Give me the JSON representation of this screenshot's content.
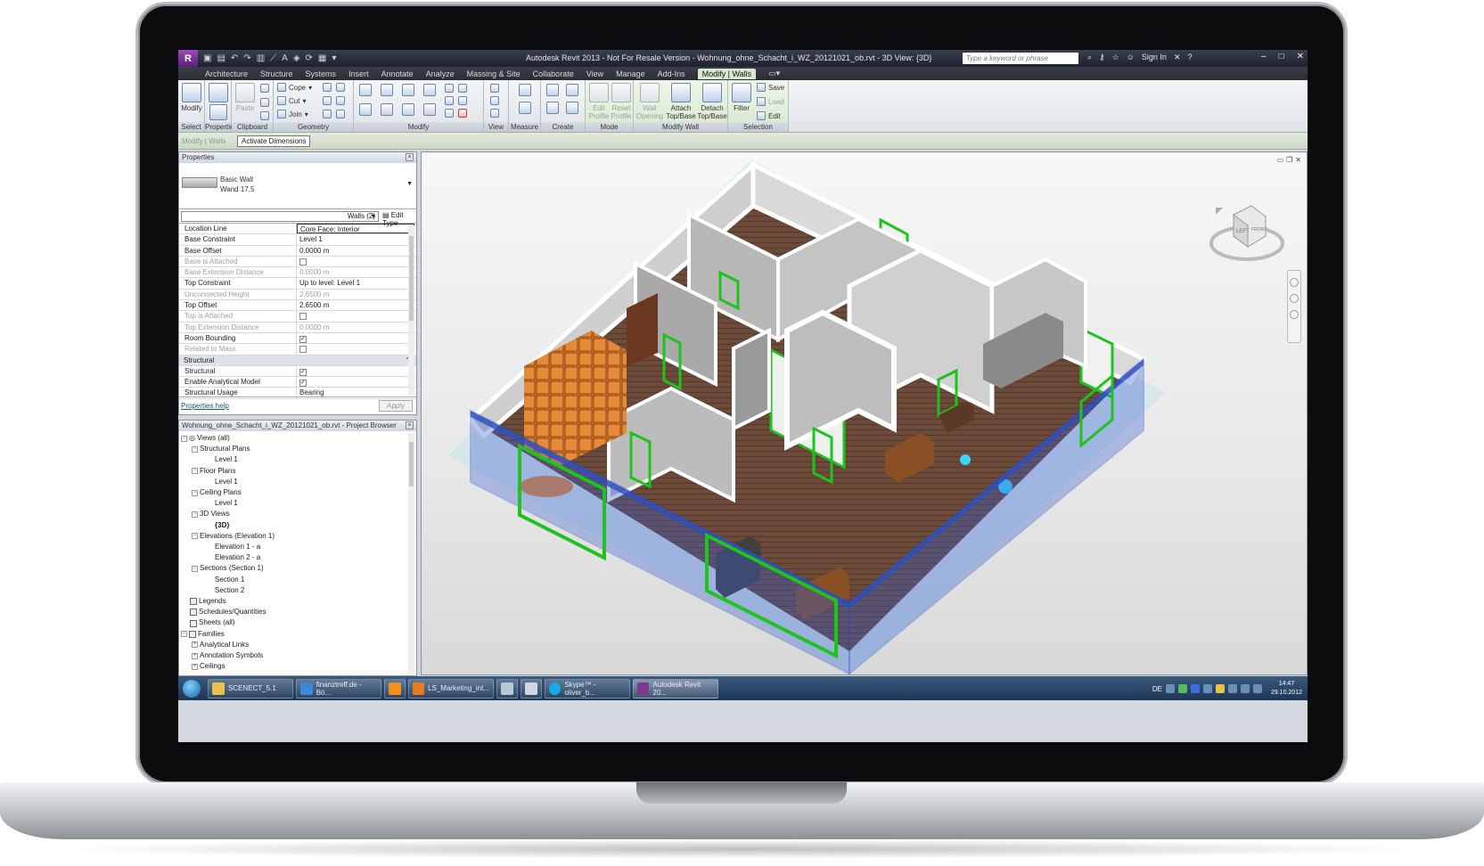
{
  "window": {
    "app_badge": "R",
    "title": "Autodesk Revit 2013 - Not For Resale Version -   Wohnung_ohne_Schacht_i_WZ_20121021_ob.rvt - 3D View: {3D}",
    "search_placeholder": "Type a keyword or phrase",
    "sign_in": "Sign In"
  },
  "tabs": [
    "Architecture",
    "Structure",
    "Systems",
    "Insert",
    "Annotate",
    "Analyze",
    "Massing & Site",
    "Collaborate",
    "View",
    "Manage",
    "Add-Ins",
    "Modify | Walls"
  ],
  "ribbon": {
    "select": {
      "button": "Modify",
      "label": "Select"
    },
    "properties": {
      "label": "Properties"
    },
    "clipboard": {
      "paste": "Paste",
      "label": "Clipboard"
    },
    "geometry": {
      "cope": "Cope",
      "cut": "Cut",
      "join": "Join",
      "label": "Geometry"
    },
    "modify": {
      "label": "Modify"
    },
    "view": {
      "label": "View"
    },
    "measure": {
      "label": "Measure"
    },
    "create": {
      "label": "Create"
    },
    "mode": {
      "edit": "Edit Profile",
      "reset": "Reset Profile",
      "label": "Mode"
    },
    "modify_wall": {
      "opening": "Wall Opening",
      "attach": "Attach Top/Base",
      "detach": "Detach Top/Base",
      "label": "Modify Wall"
    },
    "selection": {
      "filter": "Filter",
      "save": "Save",
      "load": "Load",
      "edit": "Edit",
      "label": "Selection"
    }
  },
  "options_bar": {
    "context": "Modify | Walls",
    "activate": "Activate Dimensions"
  },
  "properties": {
    "title": "Properties",
    "type_family": "Basic Wall",
    "type_name": "Wand 17,5",
    "instance_filter": "Walls (2)",
    "edit_type": "Edit Type",
    "rows": [
      {
        "k": "Location Line",
        "v": "Core Face: Interior"
      },
      {
        "k": "Base Constraint",
        "v": "Level 1"
      },
      {
        "k": "Base Offset",
        "v": "0.0000 m"
      },
      {
        "k": "Base is Attached",
        "v": ""
      },
      {
        "k": "Base Extension Distance",
        "v": "0.0000 m"
      },
      {
        "k": "Top Constraint",
        "v": "Up to level: Level 1"
      },
      {
        "k": "Unconnected Height",
        "v": "2.6500 m"
      },
      {
        "k": "Top Offset",
        "v": "2.6500 m"
      },
      {
        "k": "Top is Attached",
        "v": ""
      },
      {
        "k": "Top Extension Distance",
        "v": "0.0000 m"
      },
      {
        "k": "Room Bounding",
        "v": ""
      },
      {
        "k": "Related to Mass",
        "v": ""
      },
      {
        "k": "Structural",
        "v": ""
      },
      {
        "k": "Structural",
        "v": ""
      },
      {
        "k": "Enable Analytical Model",
        "v": ""
      },
      {
        "k": "Structural Usage",
        "v": "Bearing"
      }
    ],
    "help": "Properties help",
    "apply": "Apply"
  },
  "browser": {
    "title": "Wohnung_ohne_Schacht_i_WZ_20121021_ob.rvt - Project Browser",
    "items": [
      "Views (all)",
      "Structural Plans",
      "Level 1",
      "Floor Plans",
      "Level 1",
      "Ceiling Plans",
      "Level 1",
      "3D Views",
      "{3D}",
      "Elevations (Elevation 1)",
      "Elevation 1 - a",
      "Elevation 2 - a",
      "Sections (Section 1)",
      "Section 1",
      "Section 2",
      "Legends",
      "Schedules/Quantities",
      "Sheets (all)",
      "Families",
      "Analytical Links",
      "Annotation Symbols",
      "Ceilings"
    ]
  },
  "viewcube": {
    "left": "LEFT",
    "front": "FRONT"
  },
  "taskbar": {
    "items": [
      "SCENECT_5.1",
      "finanztreff.de - Bö...",
      "",
      "LS_Marketing_int...",
      "",
      "",
      "Skype™ - oliver_b...",
      "Autodesk Revit 20..."
    ],
    "lang": "DE",
    "time": "14:47",
    "date": "29.10.2012"
  },
  "colors": {
    "accent_green": "#1fc21f",
    "selection_blue": "#3a5fd0",
    "floor": "#6b4a3a",
    "shelf_orange": "#d8762a"
  }
}
